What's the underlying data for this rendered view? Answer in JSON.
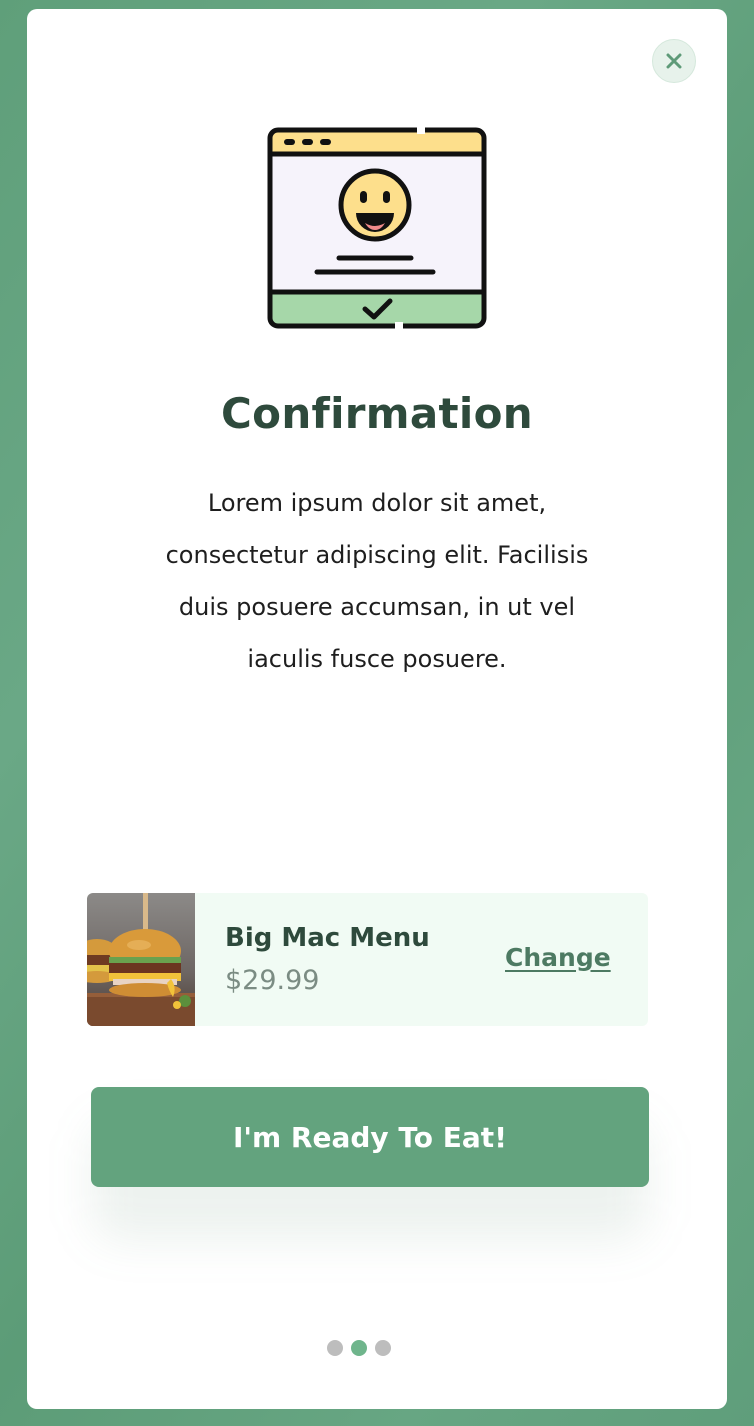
{
  "modal": {
    "close_icon": "close-icon",
    "title": "Confirmation",
    "body": "Lorem ipsum dolor sit amet, consectetur adipiscing elit. Facilisis duis posuere accumsan, in ut vel iaculis fusce posuere.",
    "illustration_icon": "confirmation-window-smiley-icon"
  },
  "product": {
    "name": "Big Mac Menu",
    "price": "$29.99",
    "change_label": "Change",
    "image_icon": "burger-image"
  },
  "cta": {
    "label": "I'm Ready To Eat!"
  },
  "pagination": {
    "total": 3,
    "active_index": 1
  },
  "colors": {
    "background": "#5f9f7a",
    "accent": "#63a37e",
    "title": "#2e4a3c",
    "product_card": "#f1fbf4",
    "dot_active": "#6fb58c",
    "dot_inactive": "#bdbdbd"
  }
}
